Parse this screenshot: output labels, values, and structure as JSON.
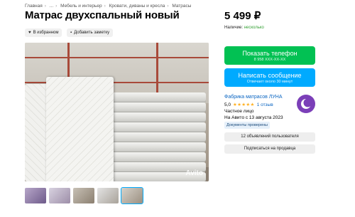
{
  "breadcrumbs": [
    "Главная",
    "...",
    "Мебель и интерьер",
    "Кровати, диваны и кресла",
    "Матрасы"
  ],
  "title": "Матрас двухспальный новый",
  "actions": {
    "favorite": "В избранном",
    "note": "Добавить заметку"
  },
  "gallery": {
    "watermark": "Avito",
    "thumbnail_count": 5,
    "active_thumbnail": 5
  },
  "price": "5 499 ₽",
  "availability": {
    "label": "Наличие:",
    "value": "несколько"
  },
  "contact": {
    "phone_button": "Показать телефон",
    "phone_masked": "8 958 XXX-XX-XX",
    "message_button": "Написать сообщение",
    "reply_time": "Отвечает около 30 минут"
  },
  "seller": {
    "name": "Фабрика матрасов ЛУНА",
    "rating": "5,0",
    "reviews": "1 отзыв",
    "type": "Частное лицо",
    "since": "На Авито с 13 августа 2023",
    "verified_badge": "Документы проверены",
    "listings_button": "12 объявлений пользователя",
    "subscribe_button": "Подписаться на продавца"
  },
  "colors": {
    "green": "#02c153",
    "blue": "#00aaff",
    "link": "#0a65c2",
    "star": "#ffb021"
  }
}
